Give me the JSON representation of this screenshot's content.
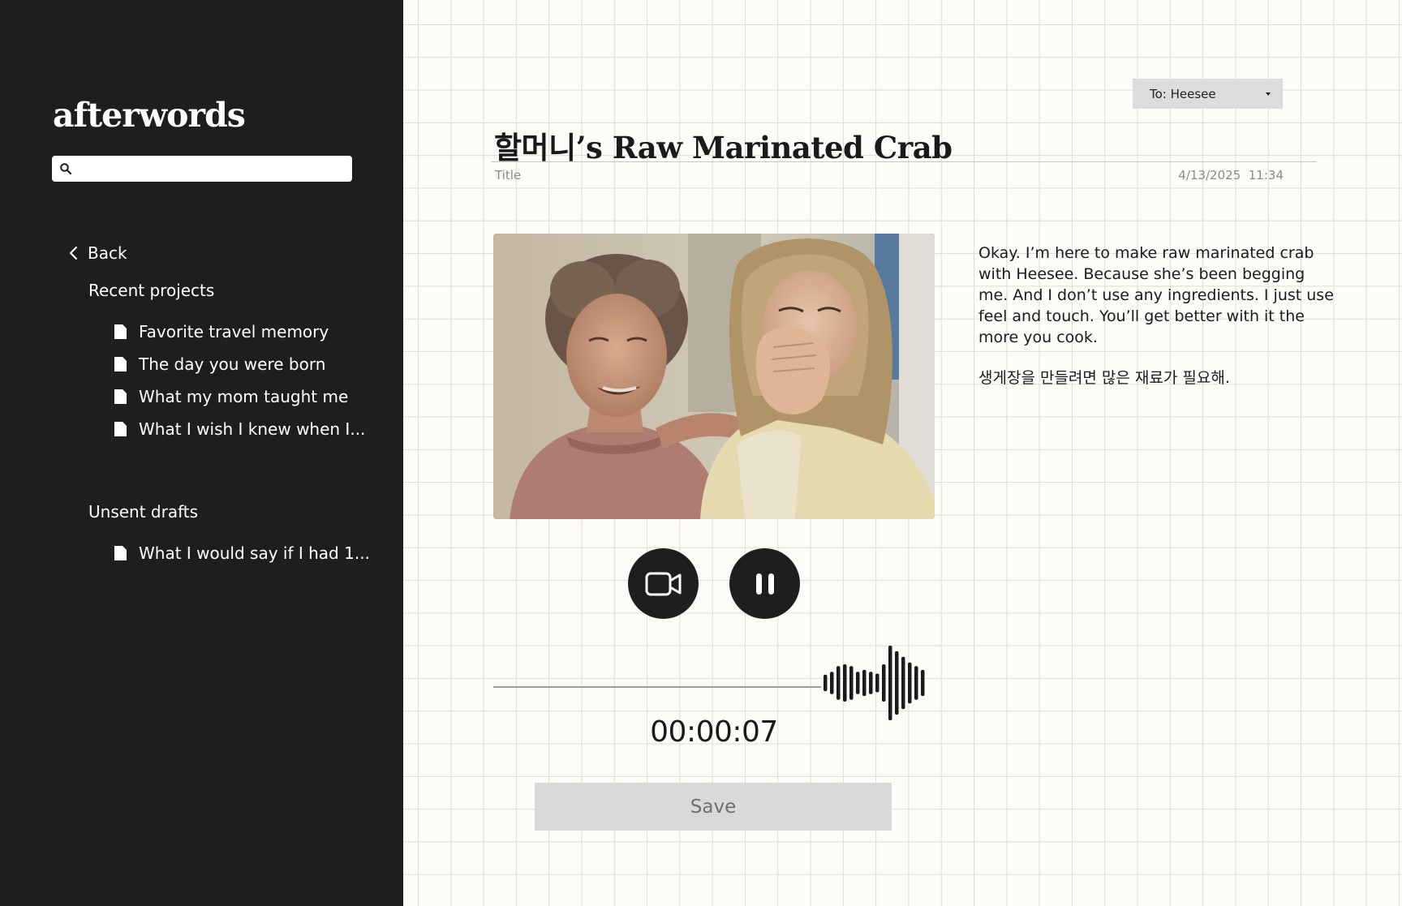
{
  "app": {
    "brand": "afterwords"
  },
  "sidebar": {
    "search": {
      "placeholder": "",
      "value": ""
    },
    "back_label": "Back",
    "recent_label": "Recent projects",
    "recent_items": [
      {
        "label": "Favorite travel memory"
      },
      {
        "label": "The day you were born"
      },
      {
        "label": "What my mom taught me"
      },
      {
        "label": "What I wish I knew when I..."
      }
    ],
    "drafts_label": "Unsent drafts",
    "draft_items": [
      {
        "label": "What I would say if I had 1..."
      }
    ]
  },
  "document": {
    "recipient": "To: Heesee",
    "title": "할머니’s Raw Marinated Crab",
    "title_label": "Title",
    "date": "4/13/2025",
    "time": "11:34"
  },
  "recording": {
    "elapsed": "00:00:07",
    "save_label": "Save",
    "waveform_levels": [
      0.22,
      0.3,
      0.45,
      0.5,
      0.45,
      0.3,
      0.35,
      0.3,
      0.25,
      0.5,
      1.0,
      0.85,
      0.7,
      0.55,
      0.45,
      0.35
    ]
  },
  "transcript": {
    "paragraphs": [
      "Okay. I’m here to make raw marinated crab with Heesee. Because she’s been begging me. And I don’t use any ingredients. I just use feel and touch. You’ll get better with it the more you cook.",
      "생게장을 만들려면 많은 재료가 필요해."
    ]
  },
  "colors": {
    "sidebar_bg": "#1e1e1e",
    "canvas_bg": "#fdfcf8",
    "grid_line": "#dddcd6",
    "button_dark": "#1e1e1e",
    "save_bg": "#d9d9d9"
  },
  "icons": {
    "search": "search-icon",
    "back": "chevron-left-icon",
    "document": "document-icon",
    "camera": "video-camera-icon",
    "pause": "pause-icon",
    "dropdown": "caret-down-icon"
  }
}
